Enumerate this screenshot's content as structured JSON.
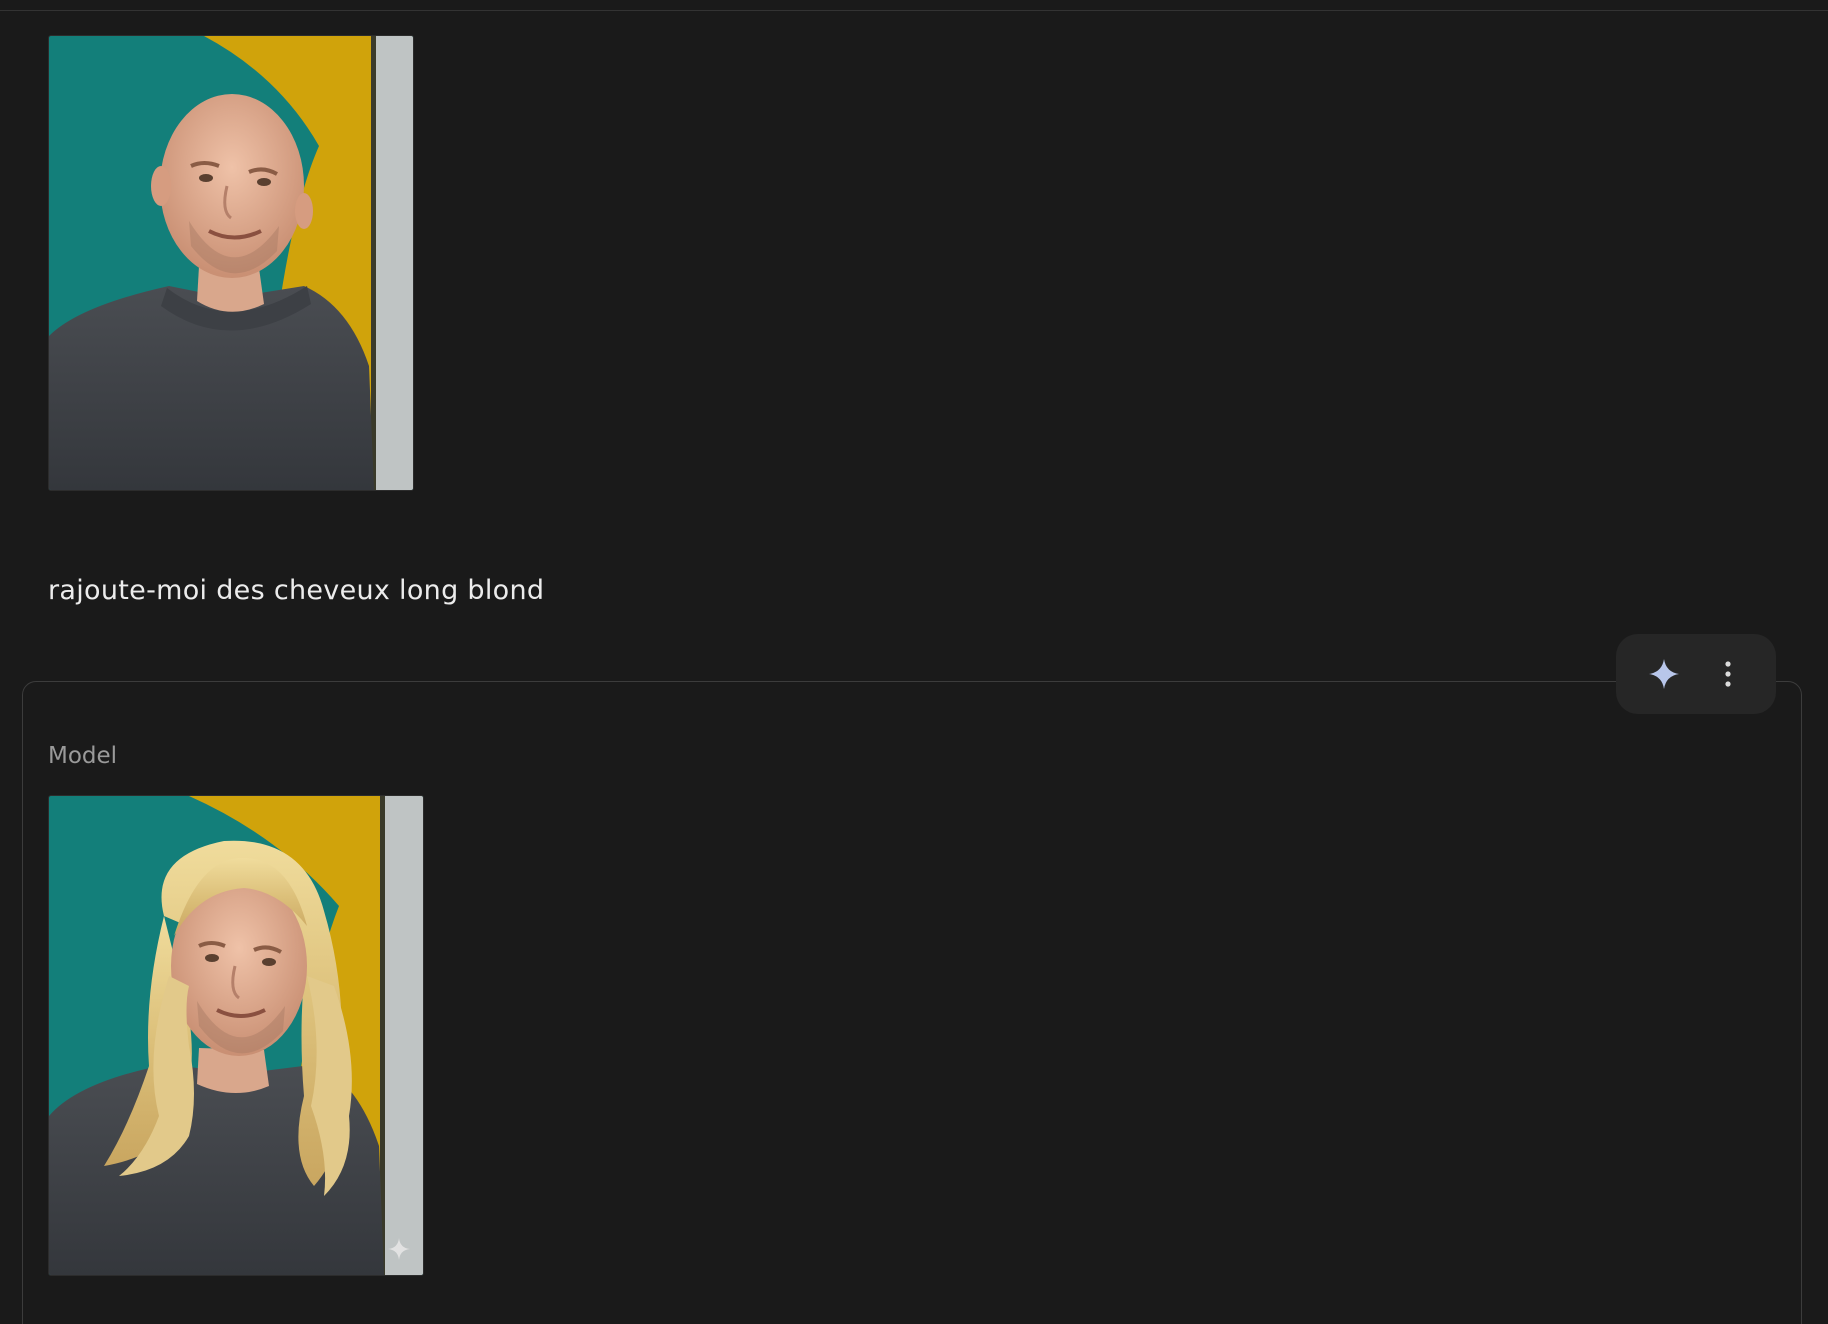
{
  "conversation": {
    "user_message": {
      "image_alt": "Photo of a bald man in a grey knit sweater",
      "prompt_text": "rajoute-moi des cheveux long blond"
    },
    "model_message": {
      "role_label": "Model",
      "image_alt": "Edited photo of the same man with long wavy blond hair"
    }
  },
  "actions": {
    "sparkle_icon": "sparkle-icon",
    "more_icon": "more-vertical-icon"
  },
  "colors": {
    "background": "#1a1a1a",
    "teal": "#137f7a",
    "mustard": "#d0a30b",
    "accent_sparkle": "#b8c6ea"
  }
}
